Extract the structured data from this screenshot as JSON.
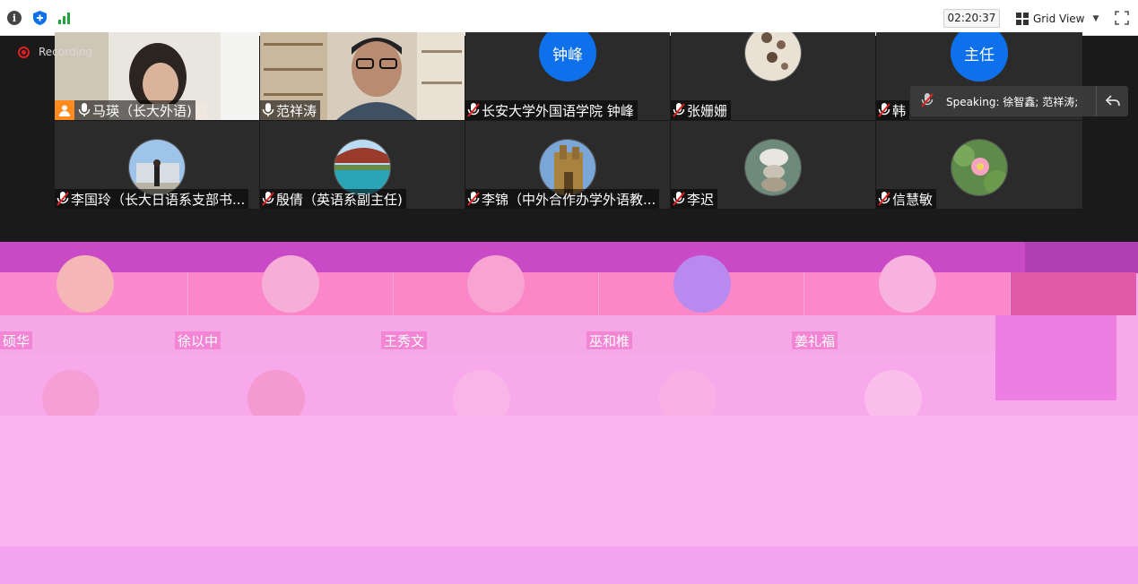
{
  "toolbar": {
    "timer": "02:20:37",
    "view_label": "Grid View"
  },
  "recording": {
    "label": "Recording"
  },
  "speaking": {
    "text": "Speaking: 徐智鑫; 范祥涛;"
  },
  "tiles": [
    {
      "name": "马瑛（长大外语)",
      "avatar_type": "video",
      "mic": "on",
      "host": true
    },
    {
      "name": "范祥涛",
      "avatar_type": "video",
      "mic": "on"
    },
    {
      "name": "长安大学外国语学院 钟峰",
      "avatar_type": "initials",
      "initials": "钟峰",
      "mic": "muted"
    },
    {
      "name": "张姗姗",
      "avatar_type": "photo",
      "mic": "muted"
    },
    {
      "name": "韩",
      "avatar_type": "initials",
      "initials": "主任",
      "mic": "muted"
    },
    {
      "name": "李国玲（长大日语系支部书...",
      "avatar_type": "photo",
      "mic": "muted"
    },
    {
      "name": "殷倩（英语系副主任)",
      "avatar_type": "photo",
      "mic": "muted"
    },
    {
      "name": "李锦（中外合作办学外语教...",
      "avatar_type": "photo",
      "mic": "muted"
    },
    {
      "name": "李迟",
      "avatar_type": "photo",
      "mic": "muted"
    },
    {
      "name": "信慧敏",
      "avatar_type": "photo",
      "mic": "muted"
    }
  ],
  "glitched_names": [
    "硕华",
    "徐以中",
    "王秀文",
    "巫和椎",
    "姜礼福"
  ],
  "colors": {
    "accent_blue": "#0e71eb",
    "host_orange": "#ff8a1e",
    "recording_red": "#e02020",
    "glitch_pink": "#f7a9ec",
    "glitch_magenta": "#c23fbf"
  }
}
